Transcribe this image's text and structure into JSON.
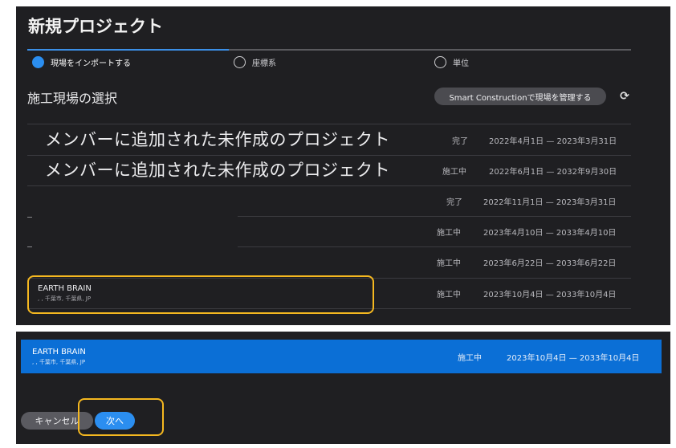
{
  "dialog": {
    "title": "新規プロジェクト"
  },
  "stepper": {
    "steps": [
      {
        "label": "現場をインポートする",
        "active": true
      },
      {
        "label": "座標系",
        "active": false
      },
      {
        "label": "単位",
        "active": false
      }
    ]
  },
  "site_selection": {
    "heading": "施工現場の選択",
    "manage_button_label": "Smart Constructionで現場を管理する",
    "refresh_icon": "refresh-icon",
    "refresh_glyph": "⟳"
  },
  "projects": [
    {
      "name": "メンバーに追加された未作成のプロジェクト",
      "address": "",
      "status": "完了",
      "dates": "2022年4月1日 — 2023年3月31日"
    },
    {
      "name": "メンバーに追加された未作成のプロジェクト",
      "address": "",
      "status": "施工中",
      "dates": "2022年6月1日 — 2032年9月30日"
    },
    {
      "name": "",
      "address": "",
      "status": "完了",
      "dates": "2022年11月1日 — 2023年3月31日"
    },
    {
      "name": "",
      "address": "",
      "status": "施工中",
      "dates": "2023年4月10日 — 2033年4月10日"
    },
    {
      "name": "",
      "address": "",
      "status": "施工中",
      "dates": "2023年6月22日 — 2033年6月22日"
    },
    {
      "name": "EARTH BRAIN",
      "address": ", , 千葉市, 千葉県, JP",
      "status": "施工中",
      "dates": "2023年10月4日 — 2033年10月4日"
    }
  ],
  "selected_project": {
    "name": "EARTH BRAIN",
    "address": ", , 千葉市, 千葉県, JP",
    "status": "施工中",
    "dates": "2023年10月4日 — 2033年10月4日"
  },
  "footer": {
    "cancel_label": "キャンセル",
    "next_label": "次へ"
  },
  "colors": {
    "panel_bg": "#1f1f22",
    "accent_blue": "#2b8ef0",
    "selected_row_blue": "#0b6fd6",
    "highlight_yellow": "#f5b820"
  }
}
